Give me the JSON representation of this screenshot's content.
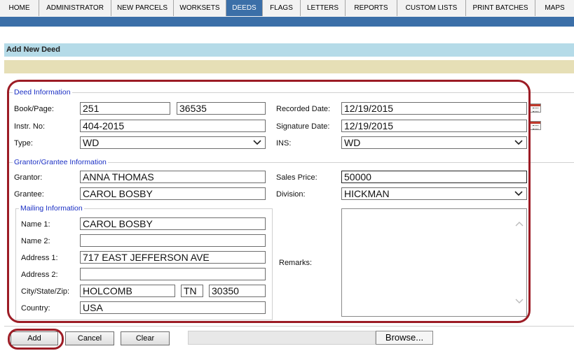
{
  "nav": {
    "tabs": [
      {
        "label": "HOME",
        "active": false
      },
      {
        "label": "ADMINISTRATOR",
        "active": false
      },
      {
        "label": "NEW PARCELS",
        "active": false
      },
      {
        "label": "WORKSETS",
        "active": false
      },
      {
        "label": "DEEDS",
        "active": true
      },
      {
        "label": "FLAGS",
        "active": false
      },
      {
        "label": "LETTERS",
        "active": false
      },
      {
        "label": "REPORTS",
        "active": false
      },
      {
        "label": "CUSTOM LISTS",
        "active": false
      },
      {
        "label": "PRINT BATCHES",
        "active": false
      },
      {
        "label": "MAPS",
        "active": false
      }
    ]
  },
  "page": {
    "title": "Add New Deed"
  },
  "deed_info": {
    "legend": "Deed Information",
    "book_page_label": "Book/Page:",
    "book": "251",
    "page": "36535",
    "recorded_date_label": "Recorded Date:",
    "recorded_date": "12/19/2015",
    "instr_no_label": "Instr. No:",
    "instr_no": "404-2015",
    "signature_date_label": "Signature Date:",
    "signature_date": "12/19/2015",
    "type_label": "Type:",
    "type": "WD",
    "ins_label": "INS:",
    "ins": "WD"
  },
  "grantor_info": {
    "legend": "Grantor/Grantee Information",
    "grantor_label": "Grantor:",
    "grantor": "ANNA THOMAS",
    "sales_price_label": "Sales Price:",
    "sales_price": "50000",
    "grantee_label": "Grantee:",
    "grantee": "CAROL BOSBY",
    "division_label": "Division:",
    "division": "HICKMAN",
    "remarks_label": "Remarks:"
  },
  "mailing": {
    "legend": "Mailing Information",
    "name1_label": "Name 1:",
    "name1": "CAROL BOSBY",
    "name2_label": "Name 2:",
    "name2": "",
    "address1_label": "Address 1:",
    "address1": "717 EAST JEFFERSON AVE",
    "address2_label": "Address 2:",
    "address2": "",
    "city_state_zip_label": "City/State/Zip:",
    "city": "HOLCOMB",
    "state": "TN",
    "zip": "30350",
    "country_label": "Country:",
    "country": "USA"
  },
  "actions": {
    "add": "Add",
    "cancel": "Cancel",
    "clear": "Clear",
    "browse": "Browse..."
  },
  "colors": {
    "nav_active": "#3b6fa8",
    "title_bar": "#b5dbe8",
    "tan_bar": "#e6dfb6",
    "legend_text": "#1a2fc4",
    "highlight": "#9c1c25"
  }
}
